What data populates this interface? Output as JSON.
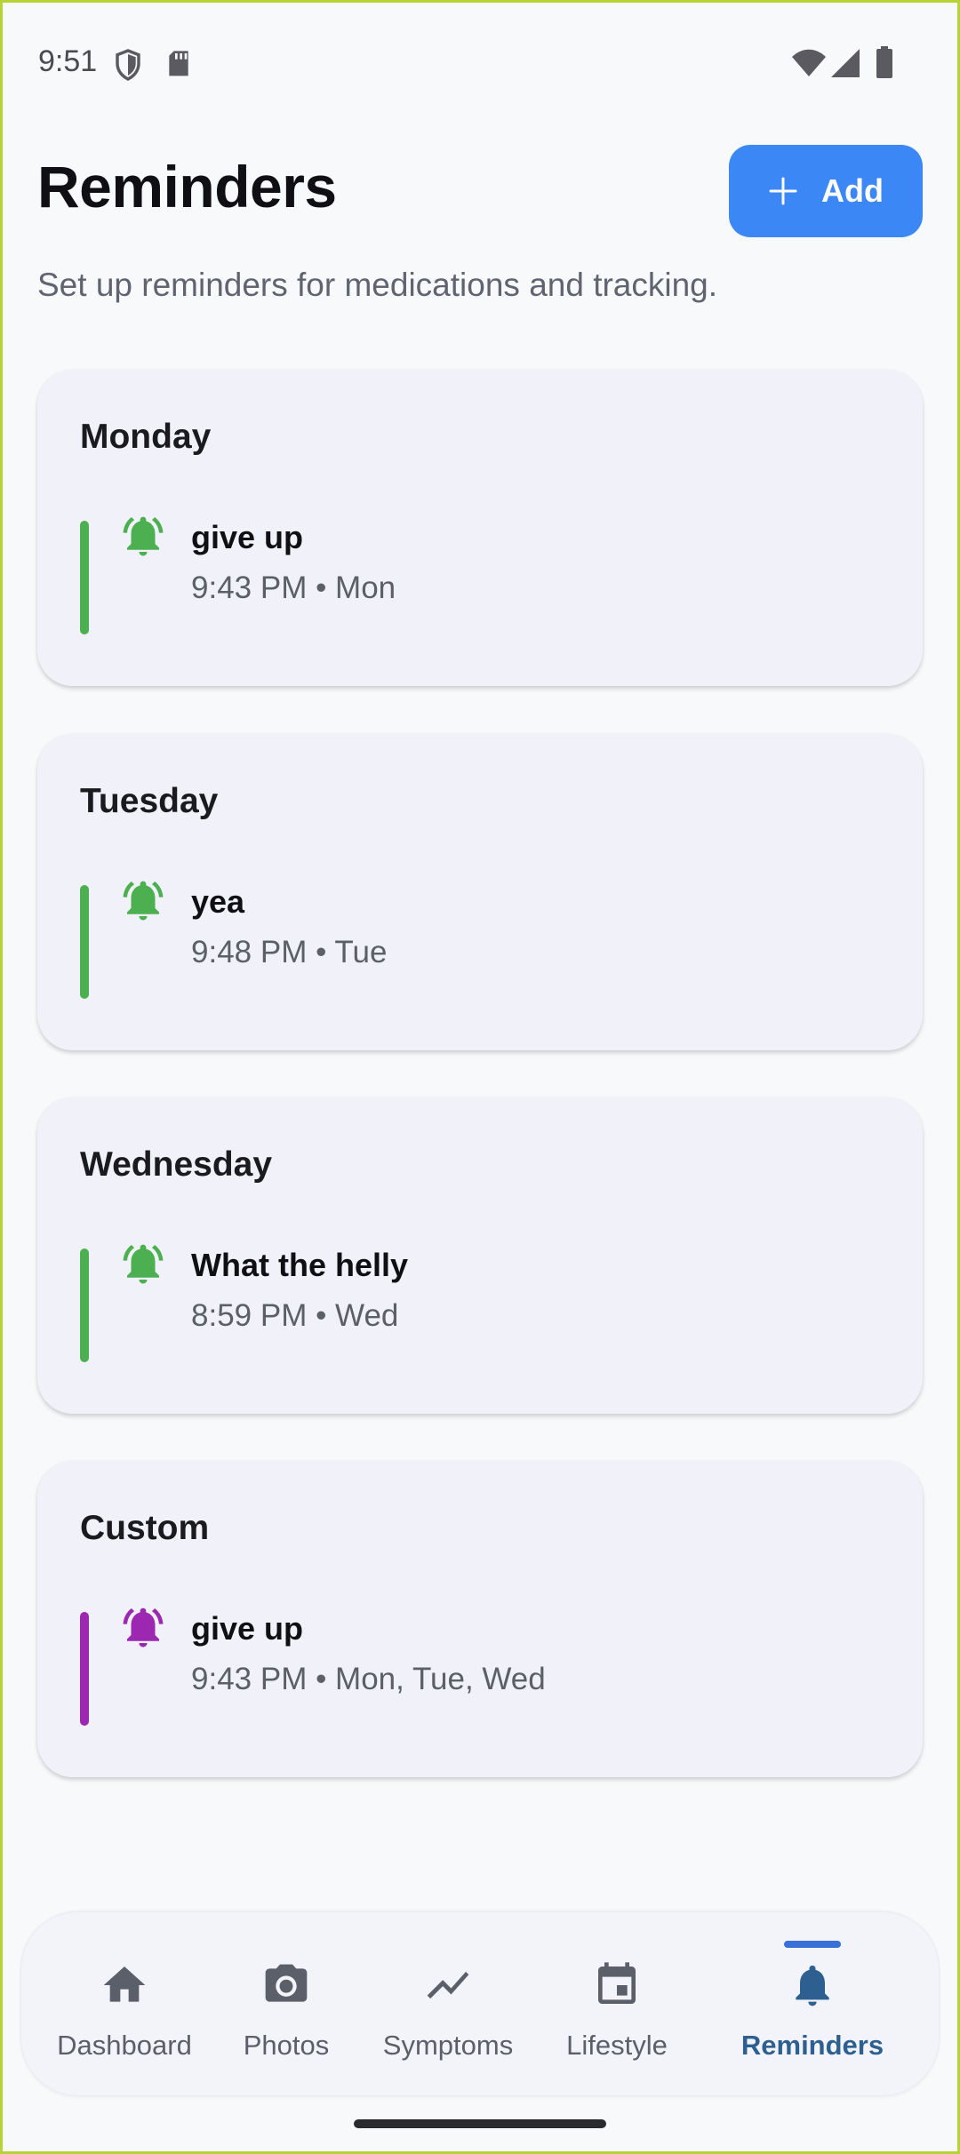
{
  "status_bar": {
    "time": "9:51",
    "icons": [
      "shield-icon",
      "sd-card-icon",
      "wifi-icon",
      "signal-icon",
      "battery-icon"
    ]
  },
  "header": {
    "title": "Reminders",
    "add_label": "Add",
    "add_icon": "plus-icon",
    "subtitle": "Set up reminders for medications and tracking."
  },
  "colors": {
    "accent": "#3b87f5",
    "green": "#4caf50",
    "purple": "#9c27b0",
    "nav_active": "#2e5f91"
  },
  "groups": [
    {
      "title": "Monday",
      "reminder": {
        "title": "give up",
        "meta": "9:43 PM • Mon",
        "color": "#4caf50",
        "icon": "bell-ringing-icon"
      }
    },
    {
      "title": "Tuesday",
      "reminder": {
        "title": "yea",
        "meta": "9:48 PM • Tue",
        "color": "#4caf50",
        "icon": "bell-ringing-icon"
      }
    },
    {
      "title": "Wednesday",
      "reminder": {
        "title": "What the helly",
        "meta": "8:59 PM • Wed",
        "color": "#4caf50",
        "icon": "bell-ringing-icon"
      }
    },
    {
      "title": "Custom",
      "reminder": {
        "title": "give up",
        "meta": "9:43 PM • Mon, Tue, Wed",
        "color": "#9c27b0",
        "icon": "bell-ringing-icon"
      }
    }
  ],
  "nav": {
    "items": [
      {
        "label": "Dashboard",
        "icon": "home-icon"
      },
      {
        "label": "Photos",
        "icon": "camera-icon"
      },
      {
        "label": "Symptoms",
        "icon": "trend-icon"
      },
      {
        "label": "Lifestyle",
        "icon": "calendar-icon"
      },
      {
        "label": "Reminders",
        "icon": "bell-icon",
        "active": true
      }
    ]
  }
}
